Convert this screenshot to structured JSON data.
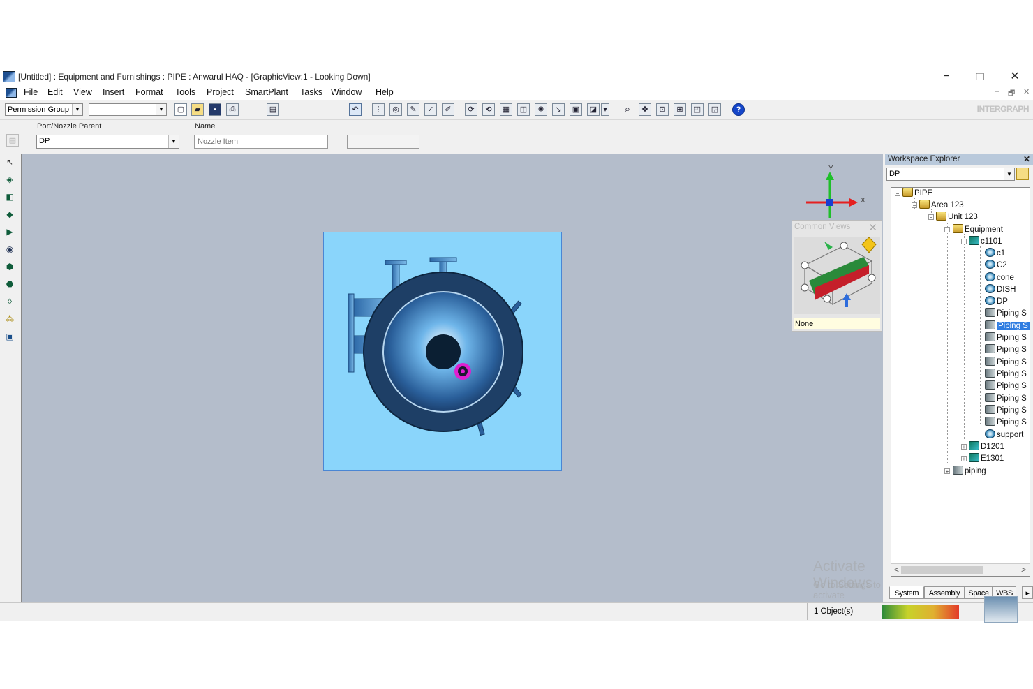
{
  "window": {
    "title": "[Untitled] : Equipment and Furnishings : PIPE : Anwarul HAQ - [GraphicView:1 - Looking Down]",
    "minimize": "−",
    "restore": "❐",
    "close": "✕"
  },
  "menu": {
    "items": [
      "File",
      "Edit",
      "View",
      "Insert",
      "Format",
      "Tools",
      "Project",
      "SmartPlant",
      "Tasks",
      "Window",
      "Help"
    ],
    "mdi_minimize": "–",
    "mdi_restore": "🗗",
    "mdi_close": "✕"
  },
  "toolbar": {
    "permission_group": "Permission Group",
    "secondary_combo": "",
    "brand": "INTERGRAPH"
  },
  "ribbon": {
    "parent_label": "Port/Nozzle Parent",
    "parent_value": "DP",
    "name_label": "Name",
    "name_placeholder": "Nozzle Item",
    "extra_field": ""
  },
  "triad": {
    "x_label": "X",
    "y_label": "Y"
  },
  "common_views": {
    "title": "Common Views",
    "close": "✕",
    "selected": "None"
  },
  "workspace_explorer": {
    "title": "Workspace Explorer",
    "close": "✕",
    "filter": "DP",
    "tree": {
      "pipe": "PIPE",
      "area": "Area 123",
      "unit": "Unit 123",
      "equipment": "Equipment",
      "c1101": "c1101",
      "children": [
        "c1",
        "C2",
        "cone",
        "DISH",
        "DP",
        "Piping S",
        "Piping S",
        "Piping S",
        "Piping S",
        "Piping S",
        "Piping S",
        "Piping S",
        "Piping S",
        "Piping S",
        "Piping S",
        "support"
      ],
      "d1201": "D1201",
      "e1301": "E1301",
      "piping": "piping"
    },
    "tabs": [
      "System",
      "Assembly",
      "Space",
      "WBS"
    ],
    "scroll_left": "<",
    "scroll_right": ">",
    "tab_next": "▸"
  },
  "status": {
    "objects": "1 Object(s)"
  },
  "overlay": {
    "activate_title": "Activate Windows",
    "activate_sub": "Go to Settings to activate Windows."
  },
  "colors": {
    "viewport_bg": "#b4bdcb",
    "vessel_box": "#8ad5fb",
    "selection": "#2f7de1",
    "nozzle_highlight": "#e01fd0"
  }
}
